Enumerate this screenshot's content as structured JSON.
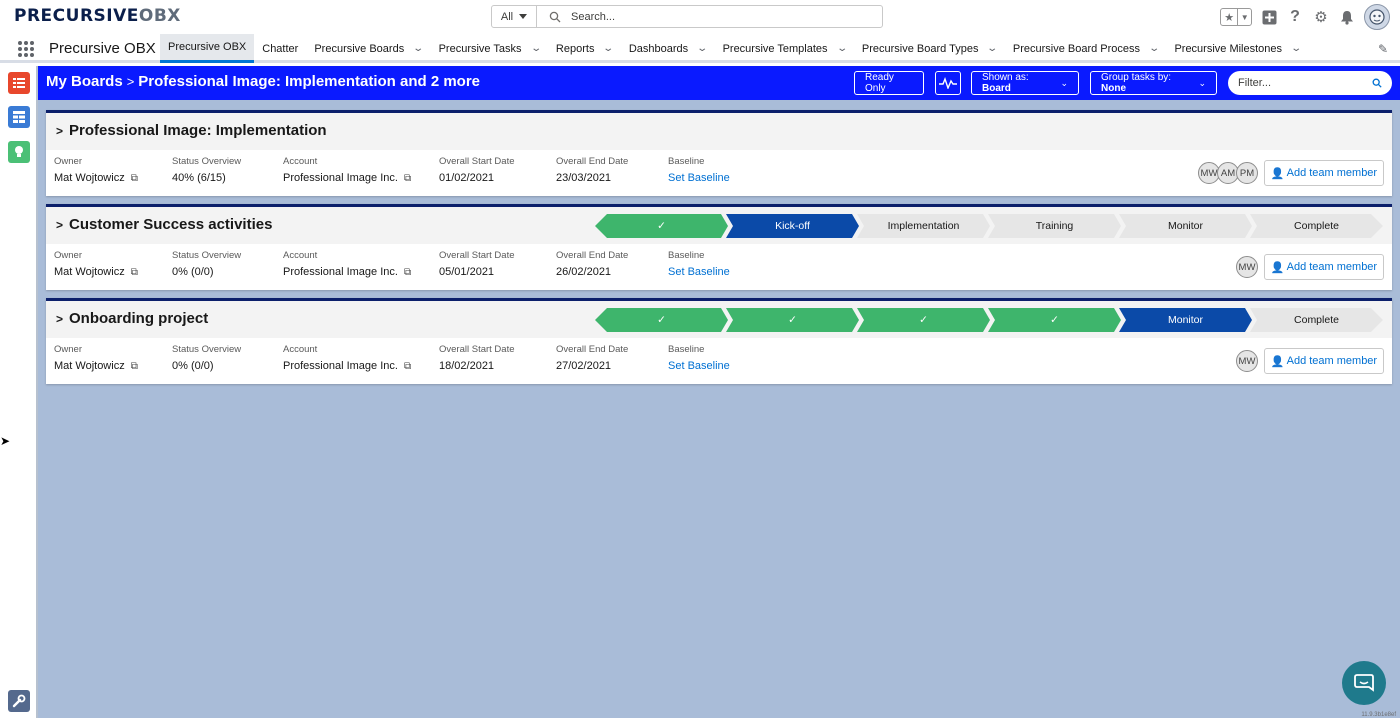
{
  "header": {
    "logo_a": "PRECURSIVE",
    "logo_b": "OBX",
    "search_scope": "All",
    "search_placeholder": "Search...",
    "icons": [
      "star-icon",
      "add-icon",
      "help-icon",
      "gear-icon",
      "bell-icon",
      "avatar"
    ]
  },
  "nav": {
    "app_name": "Precursive OBX",
    "items": [
      {
        "label": "Precursive OBX",
        "dropdown": false,
        "active": true
      },
      {
        "label": "Chatter",
        "dropdown": false
      },
      {
        "label": "Precursive Boards",
        "dropdown": true
      },
      {
        "label": "Precursive Tasks",
        "dropdown": true
      },
      {
        "label": "Reports",
        "dropdown": true
      },
      {
        "label": "Dashboards",
        "dropdown": true
      },
      {
        "label": "Precursive Templates",
        "dropdown": true
      },
      {
        "label": "Precursive Board Types",
        "dropdown": true
      },
      {
        "label": "Precursive Board Process",
        "dropdown": true
      },
      {
        "label": "Precursive Milestones",
        "dropdown": true
      }
    ]
  },
  "board_header": {
    "crumb_root": "My Boards",
    "crumb_sep": ">",
    "crumb_current": "Professional Image: Implementation and 2 more",
    "ready_only": "Ready Only",
    "shown_as_label": "Shown as:",
    "shown_as_value": "Board",
    "group_label": "Group tasks by:",
    "group_value": "None",
    "filter_placeholder": "Filter..."
  },
  "labels": {
    "owner": "Owner",
    "status": "Status Overview",
    "account": "Account",
    "start": "Overall Start Date",
    "end": "Overall End Date",
    "baseline": "Baseline",
    "set_baseline": "Set Baseline",
    "add_team": "Add team member"
  },
  "boards": [
    {
      "title": "Professional Image: Implementation",
      "owner": "Mat Wojtowicz",
      "status": "40% (6/15)",
      "account": "Professional Image Inc.",
      "start": "01/02/2021",
      "end": "23/03/2021",
      "team": [
        "MW",
        "AM",
        "PM"
      ]
    },
    {
      "title": "Customer Success activities",
      "owner": "Mat Wojtowicz",
      "status": "0% (0/0)",
      "account": "Professional Image Inc.",
      "start": "05/01/2021",
      "end": "26/02/2021",
      "team": [
        "MW"
      ],
      "path": [
        {
          "label": "✓",
          "state": "done"
        },
        {
          "label": "Kick-off",
          "state": "current"
        },
        {
          "label": "Implementation",
          "state": "todo"
        },
        {
          "label": "Training",
          "state": "todo"
        },
        {
          "label": "Monitor",
          "state": "todo"
        },
        {
          "label": "Complete",
          "state": "todo"
        }
      ]
    },
    {
      "title": "Onboarding project",
      "owner": "Mat Wojtowicz",
      "status": "0% (0/0)",
      "account": "Professional Image Inc.",
      "start": "18/02/2021",
      "end": "27/02/2021",
      "team": [
        "MW"
      ],
      "path": [
        {
          "label": "✓",
          "state": "done"
        },
        {
          "label": "✓",
          "state": "done"
        },
        {
          "label": "✓",
          "state": "done"
        },
        {
          "label": "✓",
          "state": "done"
        },
        {
          "label": "Monitor",
          "state": "current"
        },
        {
          "label": "Complete",
          "state": "todo"
        }
      ]
    }
  ],
  "colors": {
    "board_header": "#0a1aff",
    "path_done": "#3eb56c",
    "path_current": "#0b4aa8",
    "path_todo": "#e6e6e6",
    "link": "#0070d2",
    "main_bg": "#a9bcd8"
  },
  "footer": {
    "version": "11.9.3b1e8ef"
  }
}
